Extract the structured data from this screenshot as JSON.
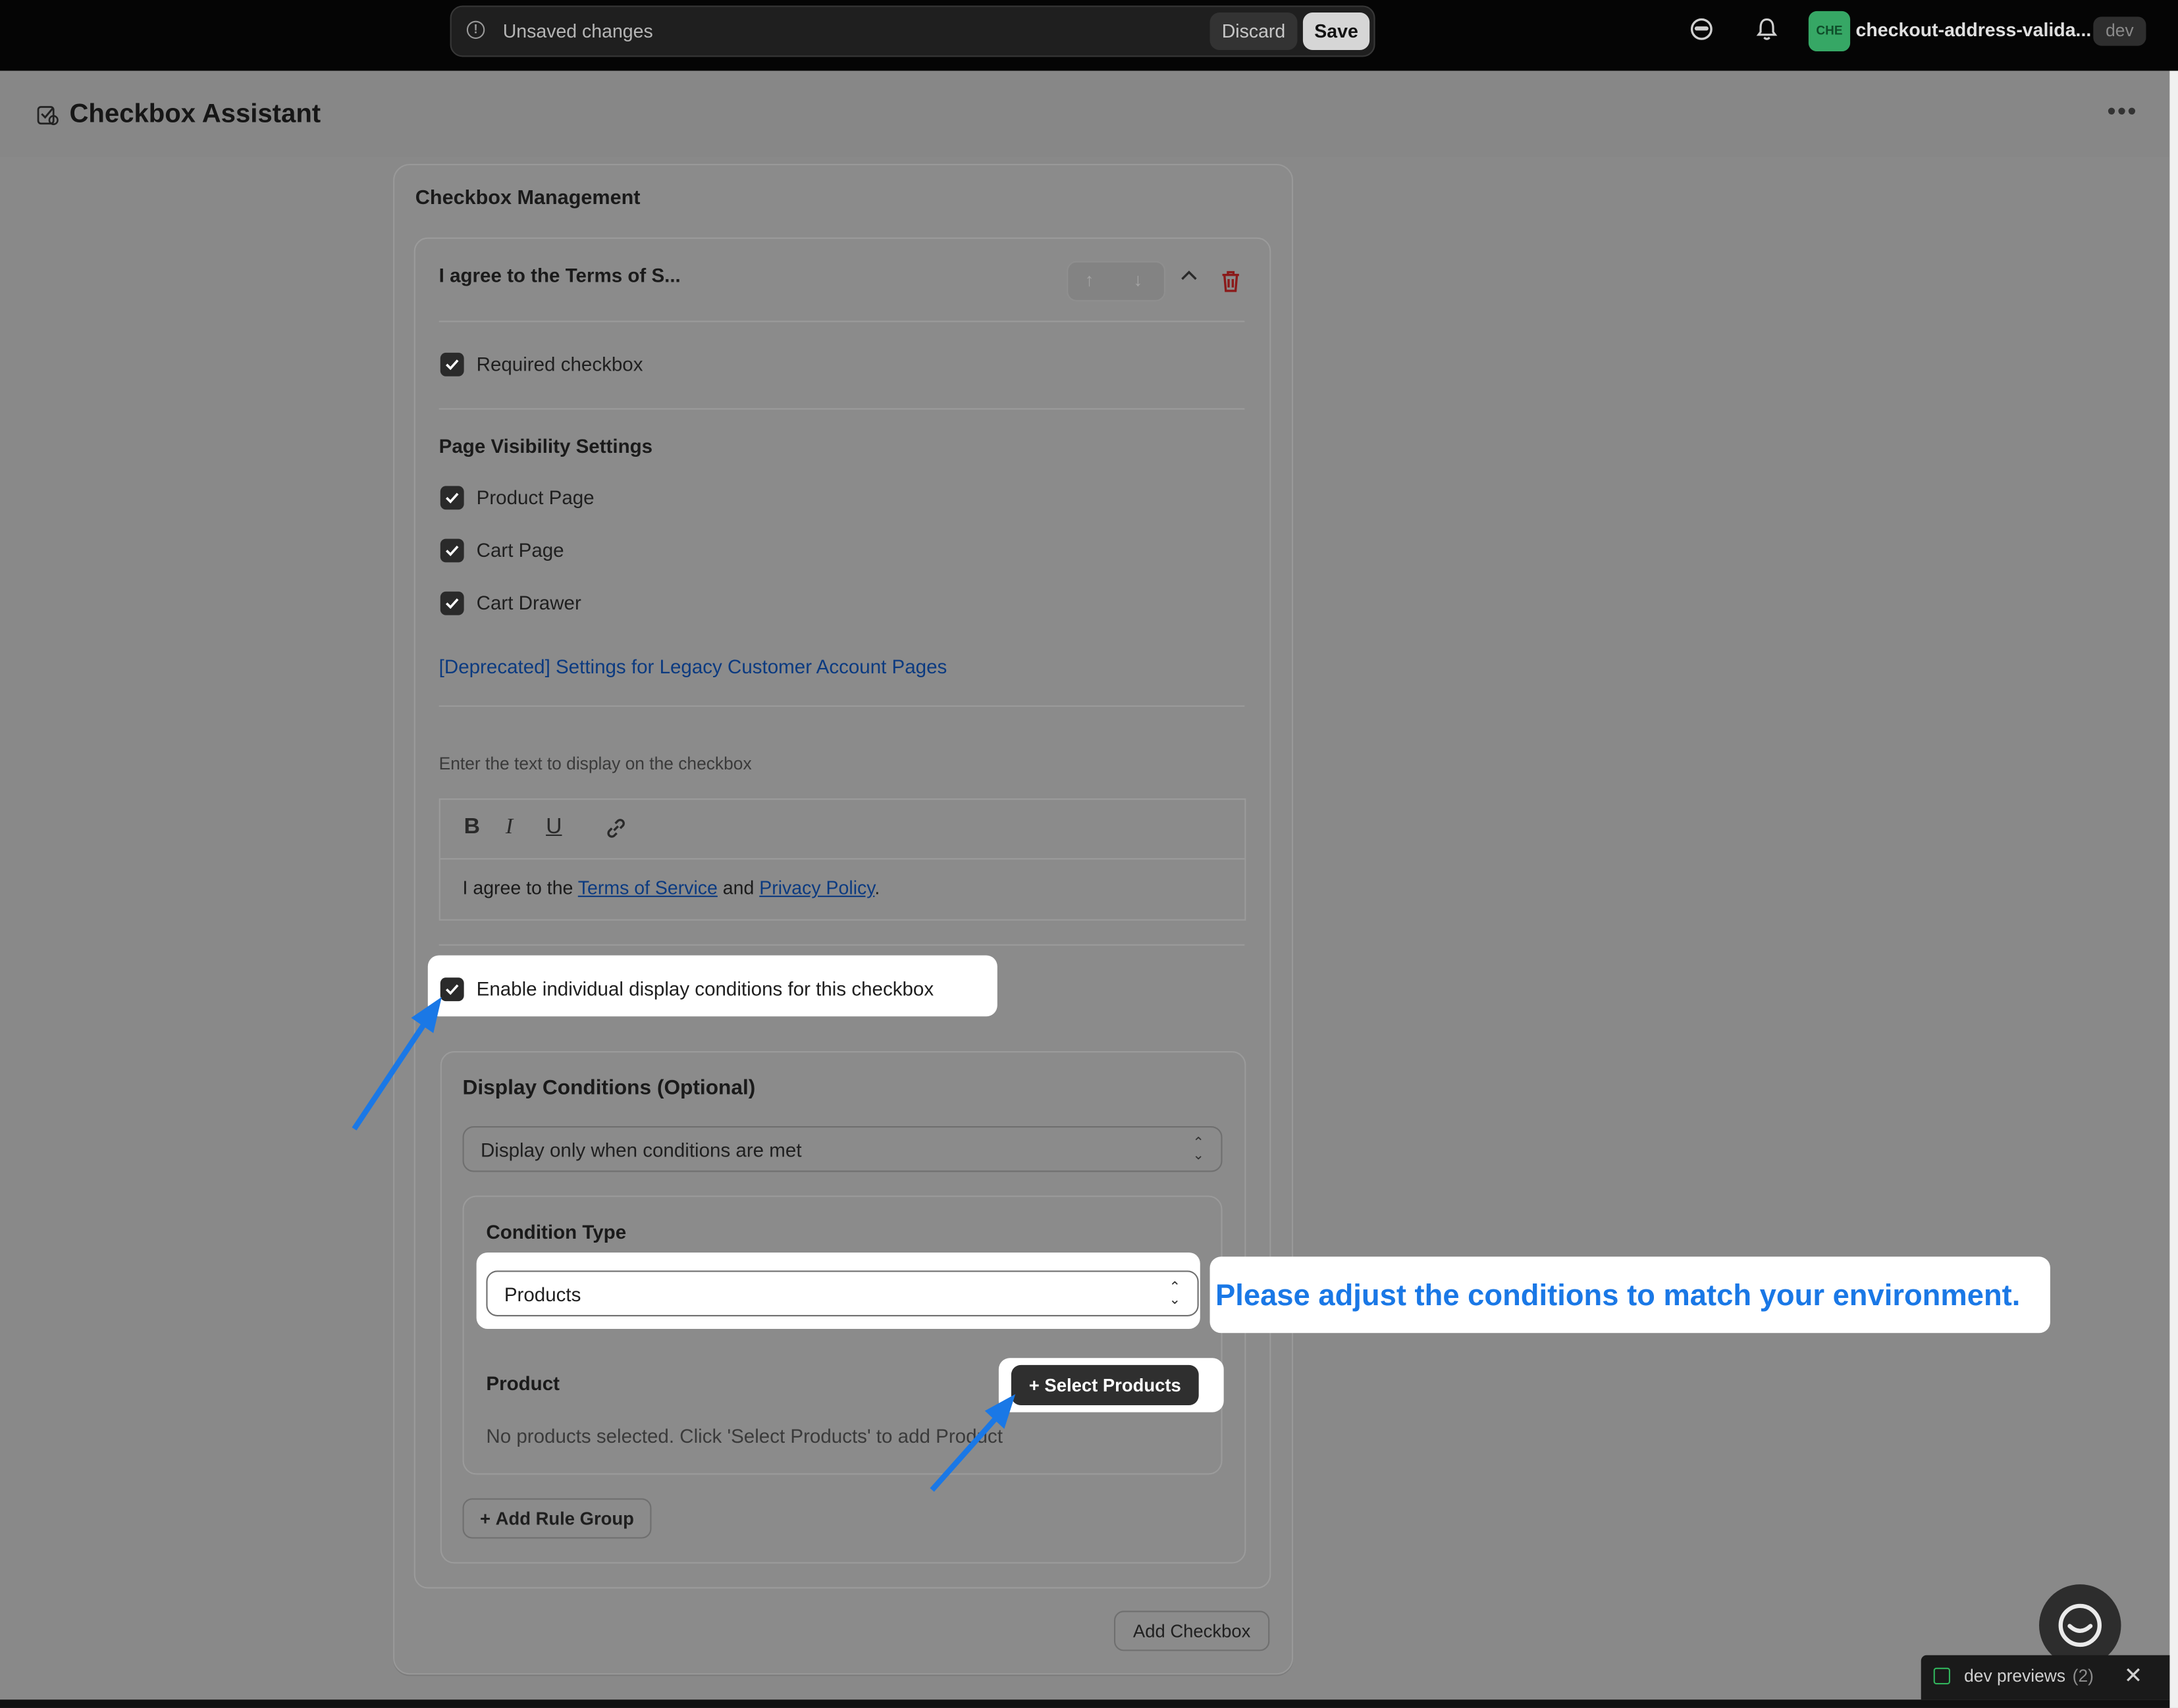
{
  "topbar": {
    "unsaved_text": "Unsaved changes",
    "discard_label": "Discard",
    "save_label": "Save",
    "store_initials": "CHE",
    "store_name": "checkout-address-valida...",
    "env_badge": "dev",
    "icons": [
      "warning-icon",
      "profile-mask-icon",
      "bell-icon"
    ]
  },
  "app": {
    "title": "Checkbox Assistant",
    "menu_icon": "more-horizontal-icon"
  },
  "card": {
    "title": "Checkbox Management",
    "checkbox_item": {
      "title": "I agree to the Terms of S...",
      "required_label": "Required checkbox",
      "required_checked": true
    },
    "page_visibility": {
      "heading": "Page Visibility Settings",
      "options": [
        {
          "label": "Product Page",
          "checked": true
        },
        {
          "label": "Cart Page",
          "checked": true
        },
        {
          "label": "Cart Drawer",
          "checked": true
        }
      ],
      "legacy_link": "[Deprecated] Settings for Legacy Customer Account Pages"
    },
    "editor": {
      "label": "Enter the text to display on the checkbox",
      "toolbar": [
        "B",
        "I",
        "U"
      ],
      "text_before": "I agree to the ",
      "link1": "Terms of Service",
      "text_mid": " and ",
      "link2": "Privacy Policy",
      "text_after": "."
    },
    "enable_conditions": {
      "label": "Enable individual display conditions for this checkbox",
      "checked": true
    },
    "display_conditions": {
      "heading": "Display Conditions (Optional)",
      "mode_value": "Display only when conditions are met",
      "condition_type_label": "Condition Type",
      "condition_type_value": "Products",
      "product_label": "Product",
      "select_products_label": "Select Products",
      "empty_text": "No products selected. Click 'Select Products' to add Product",
      "add_rule_group_label": "Add Rule Group"
    },
    "add_checkbox_label": "Add Checkbox"
  },
  "callout": {
    "text": "Please adjust the conditions to match your environment.",
    "color": "#1a78e6"
  },
  "dev_previews": {
    "label": "dev previews",
    "count": "(2)"
  },
  "colors": {
    "overlay": "#898989",
    "topbar": "#050505",
    "badge_green": "#36a765",
    "annotation_blue": "#1a78e6",
    "trash_red": "#8b1a1a"
  }
}
